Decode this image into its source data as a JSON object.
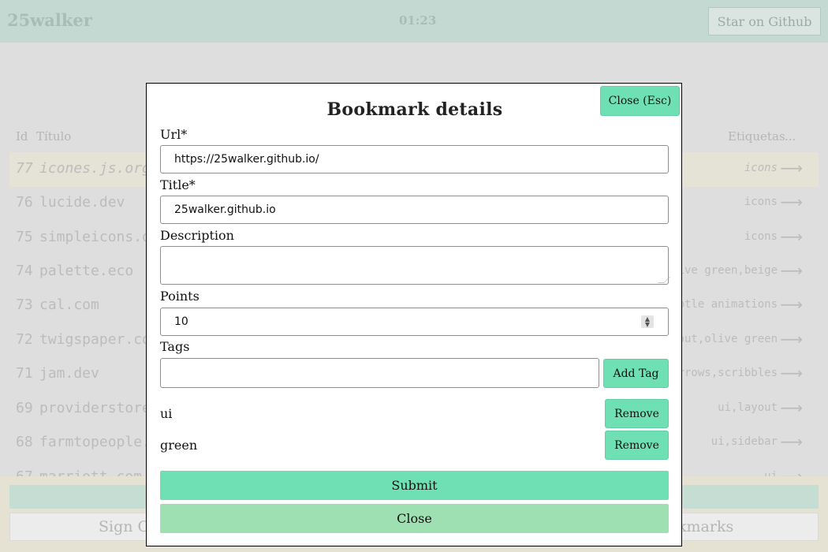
{
  "app": {
    "brand": "25walker",
    "clock": "01:23",
    "star_label": "Star on Github"
  },
  "list": {
    "headers": {
      "id": "Id",
      "title": "Título",
      "tags": "Etiquetas",
      "more": "..."
    },
    "rows": [
      {
        "id": "77",
        "title": "icones.js.org",
        "tags": "icons"
      },
      {
        "id": "76",
        "title": "lucide.dev",
        "tags": "icons"
      },
      {
        "id": "75",
        "title": "simpleicons.or",
        "tags": "icons"
      },
      {
        "id": "74",
        "title": "palette.eco",
        "tags": "live green,beige"
      },
      {
        "id": "73",
        "title": "cal.com",
        "tags": "ubtle animations"
      },
      {
        "id": "72",
        "title": "twigspaper.com",
        "tags": "ayout,olive green"
      },
      {
        "id": "71",
        "title": "jam.dev",
        "tags": "arrows,scribbles"
      },
      {
        "id": "69",
        "title": "providerstore.c",
        "tags": "ui,layout"
      },
      {
        "id": "68",
        "title": "farmtopeople.c",
        "tags": "ui,sidebar"
      },
      {
        "id": "67",
        "title": "marriott.com",
        "tags": "ui"
      }
    ],
    "arrow": "⟶"
  },
  "footer": {
    "sign_out": "Sign Ou",
    "bookmarks": "kmarks"
  },
  "modal": {
    "title": "Bookmark details",
    "close_esc": "Close (Esc)",
    "url_label": "Url*",
    "url_value": "https://25walker.github.io/",
    "title_label": "Title*",
    "title_value": "25walker.github.io",
    "description_label": "Description",
    "description_value": "",
    "points_label": "Points",
    "points_value": "10",
    "tags_label": "Tags",
    "add_tag": "Add Tag",
    "tags": [
      {
        "name": "ui",
        "remove": "Remove"
      },
      {
        "name": "green",
        "remove": "Remove"
      }
    ],
    "submit": "Submit",
    "close": "Close"
  },
  "colors": {
    "accent": "#6ee0b4",
    "close_button": "#9ee0b1",
    "topbar": "#c4d9d2"
  }
}
